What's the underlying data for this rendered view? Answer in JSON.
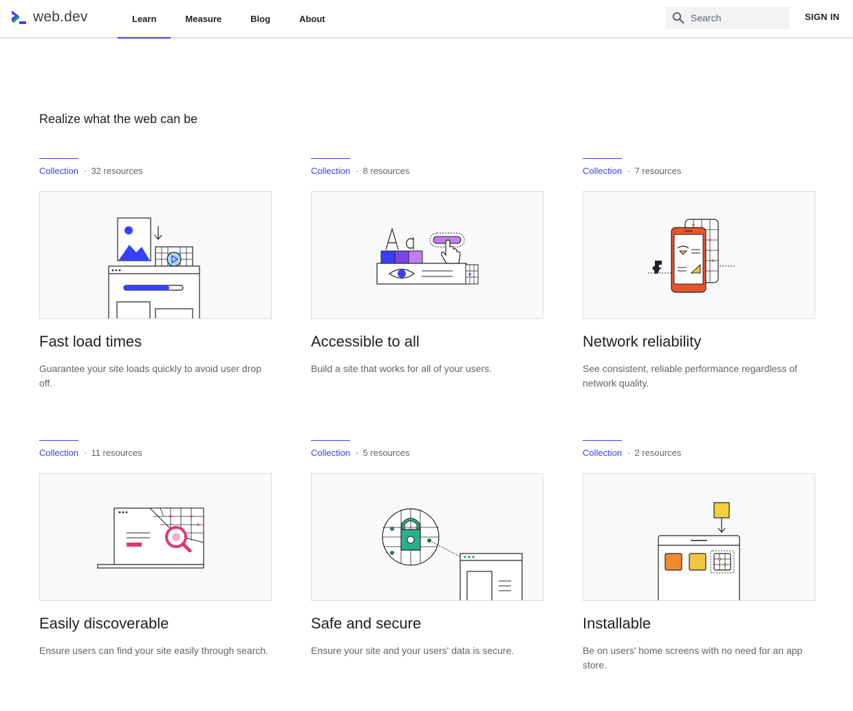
{
  "header": {
    "logo_text": "web.dev",
    "nav": [
      {
        "label": "Learn",
        "active": true
      },
      {
        "label": "Measure"
      },
      {
        "label": "Blog"
      },
      {
        "label": "About"
      }
    ],
    "search_placeholder": "Search",
    "sign_in": "SIGN IN",
    "brand_color": "#3740ff"
  },
  "main": {
    "section_title": "Realize what the web can be",
    "cards": [
      {
        "kind": "Collection",
        "count": "32 resources",
        "title": "Fast load times",
        "description": "Guarantee your site loads quickly to avoid user drop off.",
        "illustration": "fast-load-illustration"
      },
      {
        "kind": "Collection",
        "count": "8 resources",
        "title": "Accessible to all",
        "description": "Build a site that works for all of your users.",
        "illustration": "accessibility-illustration"
      },
      {
        "kind": "Collection",
        "count": "7 resources",
        "title": "Network reliability",
        "description": "See consistent, reliable performance regardless of network quality.",
        "illustration": "network-illustration"
      },
      {
        "kind": "Collection",
        "count": "11 resources",
        "title": "Easily discoverable",
        "description": "Ensure users can find your site easily through search.",
        "illustration": "discoverable-illustration"
      },
      {
        "kind": "Collection",
        "count": "5 resources",
        "title": "Safe and secure",
        "description": "Ensure your site and your users' data is secure.",
        "illustration": "security-illustration"
      },
      {
        "kind": "Collection",
        "count": "2 resources",
        "title": "Installable",
        "description": "Be on users' home screens with no need for an app store.",
        "illustration": "installable-illustration"
      }
    ]
  }
}
